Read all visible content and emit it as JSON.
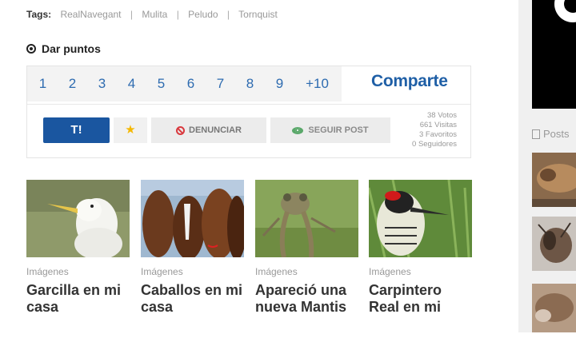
{
  "tags": {
    "label": "Tags:",
    "items": [
      "RealNavegant",
      "Mulita",
      "Peludo",
      "Tornquist"
    ],
    "separator": "|"
  },
  "dar_puntos": {
    "title": "Dar puntos",
    "points": [
      "1",
      "2",
      "3",
      "4",
      "5",
      "6",
      "7",
      "8",
      "9",
      "+10"
    ],
    "share_label": "Comparte"
  },
  "actions": {
    "t_label": "T!",
    "star_label": "★",
    "denunciar_label": "DENUNCIAR",
    "seguir_label": "SEGUIR POST"
  },
  "stats": {
    "votos": "38 Votos",
    "visitas": "661 Visitas",
    "favoritos": "3 Favoritos",
    "seguidores": "0 Seguidores"
  },
  "related": [
    {
      "category": "Imágenes",
      "title": "Garcilla en mi casa"
    },
    {
      "category": "Imágenes",
      "title": "Caballos en mi casa"
    },
    {
      "category": "Imágenes",
      "title": "Apareció una nueva Mantis"
    },
    {
      "category": "Imágenes",
      "title": "Carpintero Real en mi"
    }
  ],
  "sidebar": {
    "posts_label": "Posts"
  },
  "colors": {
    "accent": "#1f5fa6",
    "t_button": "#1a56a0",
    "star": "#f5b800",
    "denunciar_icon": "#d9393e",
    "seguir_icon": "#5aa86a"
  }
}
